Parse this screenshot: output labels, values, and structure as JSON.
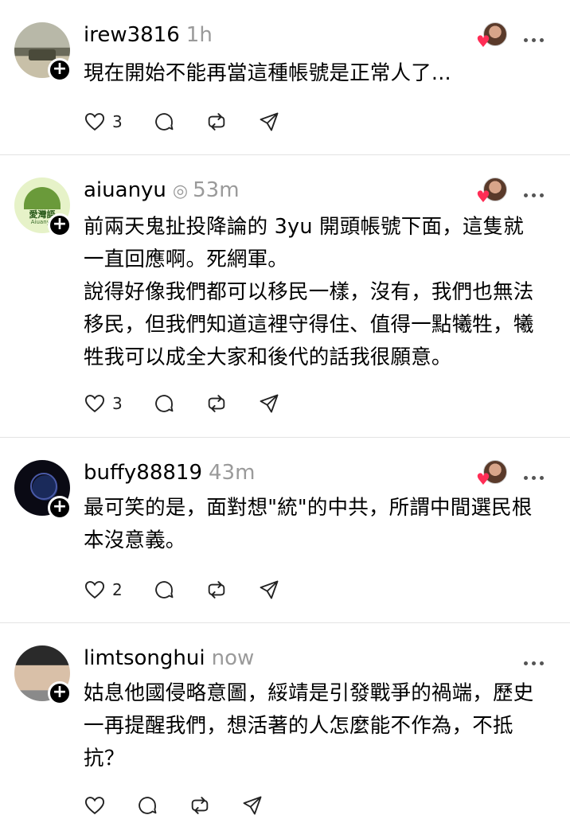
{
  "posts": [
    {
      "username": "irew3816",
      "time": "1h",
      "verified": false,
      "text": "現在開始不能再當這種帳號是正常人了...",
      "likes": "3",
      "has_liker": true,
      "avatar_colors": [
        "#8a8a7a",
        "#c8c0a8"
      ]
    },
    {
      "username": "aiuanyu",
      "time": "53m",
      "verified": true,
      "text": "前兩天鬼扯投降論的 3yu 開頭帳號下面，這隻就\n一直回應啊。死網軍。\n說得好像我們都可以移民一樣，沒有，我們也無法\n移民，但我們知道這裡守得住、值得一點犧牲，犧\n牲我可以成全大家和後代的話我很願意。",
      "likes": "3",
      "has_liker": true,
      "avatar_text": [
        "愛灣語",
        "Aiuanyu"
      ],
      "avatar_colors": [
        "#eef6d8",
        "#4a8a2a"
      ]
    },
    {
      "username": "buffy88819",
      "time": "43m",
      "verified": false,
      "text": "最可笑的是，面對想\"統\"的中共，所謂中間選民根\n本沒意義。",
      "likes": "2",
      "has_liker": true,
      "avatar_colors": [
        "#0a0a14",
        "#3a4a8a"
      ]
    },
    {
      "username": "limtsonghui",
      "time": "now",
      "verified": false,
      "text": "姑息他國侵略意圖，綏靖是引發戰爭的禍端，歷史\n一再提醒我們，想活著的人怎麼能不作為，不抵\n抗？",
      "likes": "",
      "has_liker": false,
      "avatar_colors": [
        "#d9c8b8",
        "#2a2a2a"
      ]
    }
  ],
  "icons": {
    "heart": "heart-icon",
    "reply": "reply-icon",
    "repost": "repost-icon",
    "share": "share-icon",
    "more": "more-icon",
    "follow": "plus-icon"
  },
  "colors": {
    "text": "#000000",
    "muted": "#9a9a9a",
    "divider": "#e3e3e3",
    "like_heart": "#ff2d55"
  }
}
